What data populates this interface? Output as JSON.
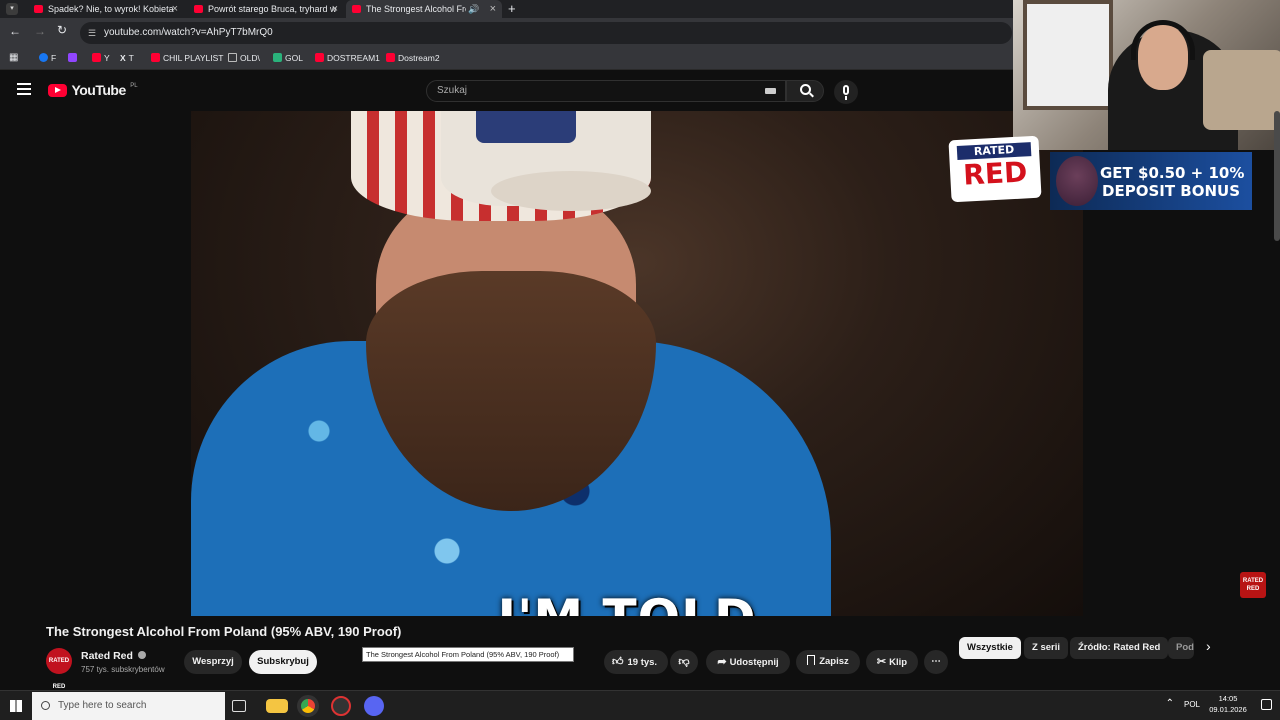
{
  "browser": {
    "tabs": [
      {
        "title": "Spadek? Nie, to wyrok! Kobieta",
        "active": false
      },
      {
        "title": "Powrót starego Bruca, tryhard w",
        "active": false
      },
      {
        "title": "The Strongest Alcohol From Poland",
        "active": true
      }
    ],
    "new_tab_icon": "plus-icon",
    "url": "youtube.com/watch?v=AhPyT7bMrQ0",
    "bookmarks": [
      {
        "label": "F",
        "icon": "facebook-icon",
        "color": "#1877f2"
      },
      {
        "label": "",
        "icon": "twitch-icon",
        "color": "#9146ff"
      },
      {
        "label": "Y",
        "icon": "youtube-icon",
        "color": "#ff0033"
      },
      {
        "label": "T",
        "icon": "x-icon",
        "color": "#ffffff"
      },
      {
        "label": "CHIL PLAYLIST",
        "icon": "youtube-icon",
        "color": "#ff0033"
      },
      {
        "label": "OLD\\",
        "icon": "folder-icon",
        "color": "#bbbbbb"
      },
      {
        "label": "GOL",
        "icon": "gol-icon",
        "color": "#2ab27b"
      },
      {
        "label": "DOSTREAM1",
        "icon": "youtube-icon",
        "color": "#ff0033"
      },
      {
        "label": "Dostream2",
        "icon": "youtube-icon",
        "color": "#ff0033"
      }
    ]
  },
  "youtube": {
    "logo_text": "YouTube",
    "logo_region": "PL",
    "search_placeholder": "Szukaj",
    "video": {
      "caption": "I'M TOLD.",
      "title": "The Strongest Alcohol From Poland (95% ABV, 190 Proof)",
      "tooltip": "The Strongest Alcohol From Poland (95% ABV, 190 Proof)"
    },
    "channel": {
      "name": "Rated Red",
      "subscribers": "757 tys. subskrybentów",
      "avatar_text": "RATED RED",
      "support_label": "Wesprzyj",
      "subscribe_label": "Subskrybuj"
    },
    "actions": {
      "like_count": "19 tys.",
      "share_label": "Udostępnij",
      "save_label": "Zapisz",
      "clip_label": "Klip"
    },
    "chips": [
      "Wszystkie",
      "Z serii",
      "Źródło: Rated Red",
      "Pod"
    ]
  },
  "overlay": {
    "ad_logo_top": "RATED",
    "ad_logo_bottom": "RED",
    "ad_line1": "GET $0.50 + 10%",
    "ad_line2": "DEPOSIT BONUS",
    "watermark": "RATED RED"
  },
  "taskbar": {
    "search_placeholder": "Type here to search",
    "language": "POL",
    "time": "14:05",
    "date": "09.01.2026"
  },
  "colors": {
    "youtube_red": "#ff0033",
    "background": "#0f0f0f",
    "accent_red": "#c1121f"
  }
}
